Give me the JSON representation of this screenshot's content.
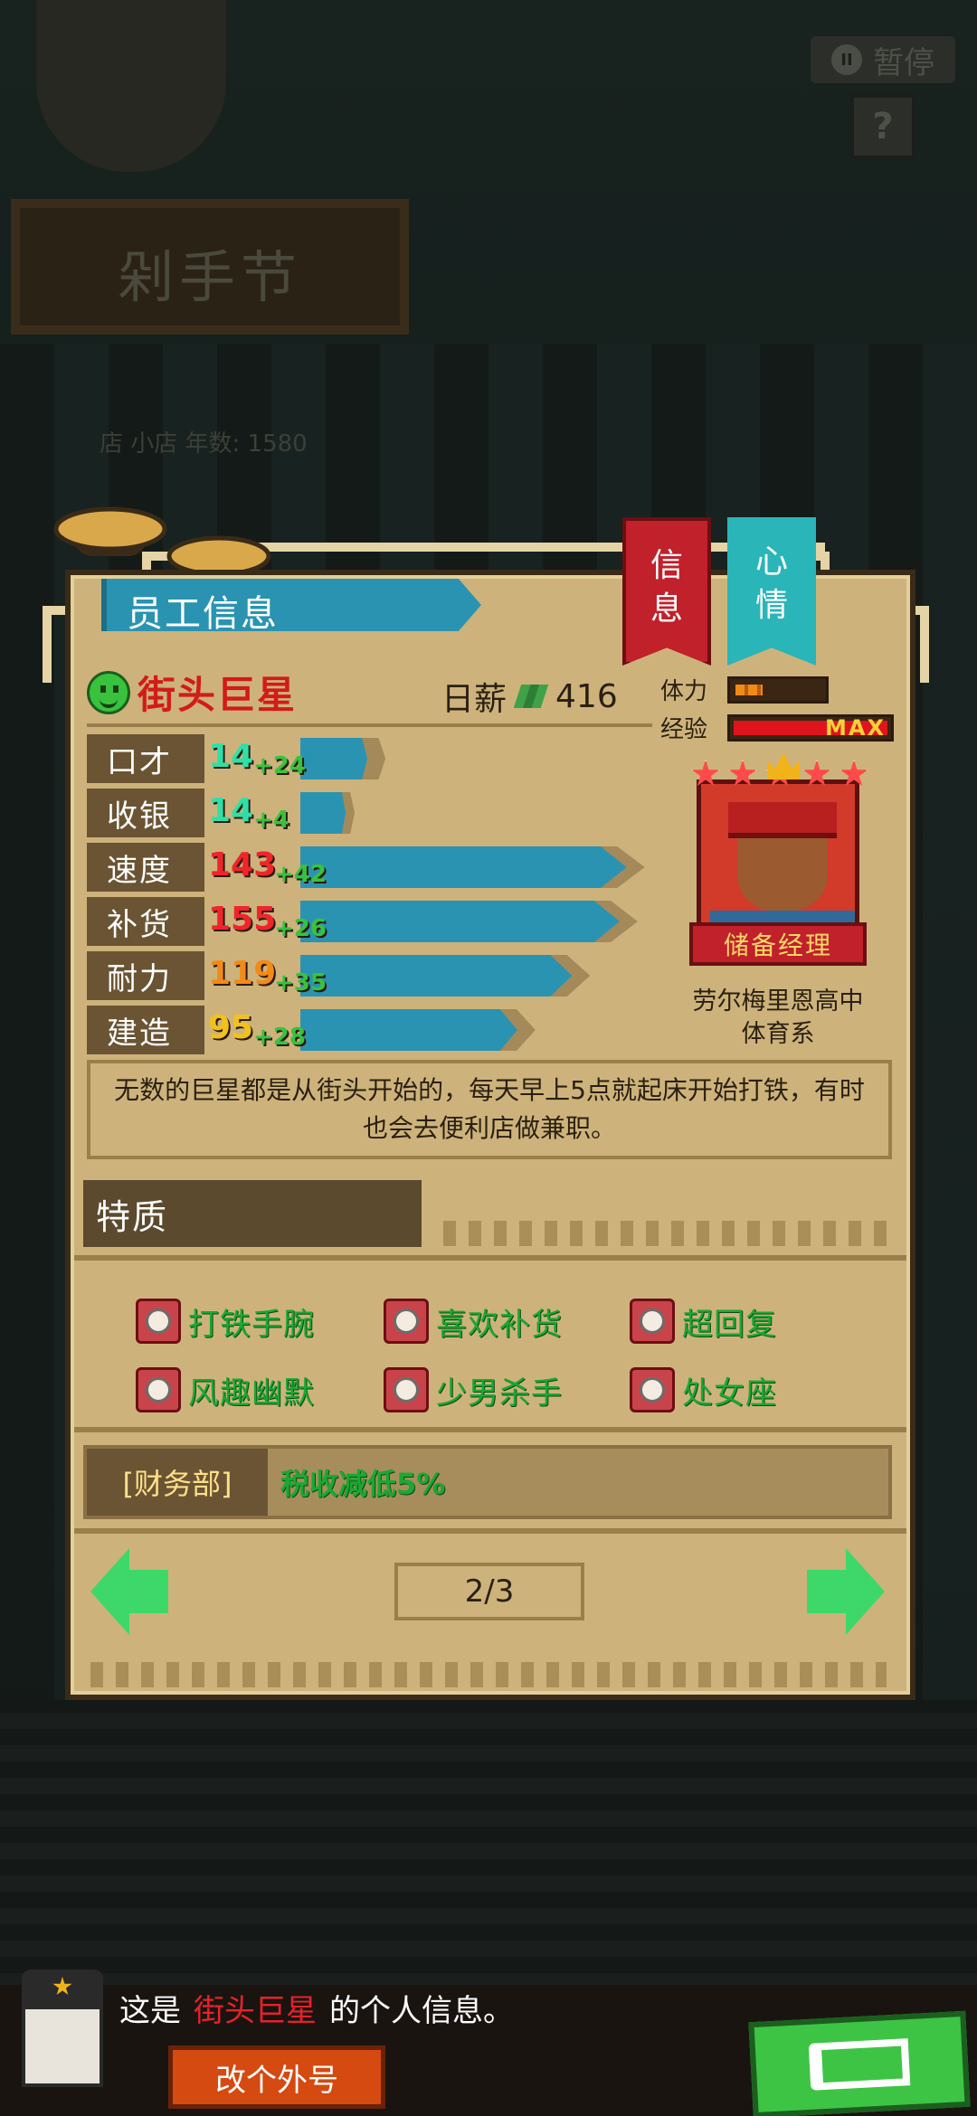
{
  "background": {
    "sign_text": "剁手节",
    "shop_text": "店 小店  年数: 1580"
  },
  "topbar": {
    "pause_label": "暂停",
    "help_label": "?"
  },
  "panel": {
    "header_title": "员工信息",
    "tab_info": [
      "信",
      "息"
    ],
    "tab_mood": [
      "心",
      "情"
    ]
  },
  "employee": {
    "name": "街头巨星",
    "salary_label": "日薪",
    "salary_value": "416",
    "stamina_label": "体力",
    "stamina_level": 0.3,
    "exp_label": "经验",
    "exp_level": 1.0,
    "exp_max_text": "MAX",
    "rank": "储备经理",
    "school_line1": "劳尔梅里恩高中",
    "school_line2": "体育系",
    "bio": "无数的巨星都是从街头开始的，每天早上5点就起床开始打铁，有时也会去便利店做兼职。"
  },
  "stats": [
    {
      "name": "口才",
      "value": "14",
      "bonus": "+24",
      "color": "#2ee0a8"
    },
    {
      "name": "收银",
      "value": "14",
      "bonus": "+4",
      "color": "#2ee0a8"
    },
    {
      "name": "速度",
      "value": "143",
      "bonus": "+42",
      "color": "#f0252a"
    },
    {
      "name": "补货",
      "value": "155",
      "bonus": "+26",
      "color": "#f0252a"
    },
    {
      "name": "耐力",
      "value": "119",
      "bonus": "+35",
      "color": "#f28a18"
    },
    {
      "name": "建造",
      "value": "95",
      "bonus": "+28",
      "color": "#f2c21a"
    }
  ],
  "traits": {
    "title": "特质",
    "items": [
      "打铁手腕",
      "喜欢补货",
      "超回复",
      "风趣幽默",
      "少男杀手",
      "处女座"
    ]
  },
  "department": {
    "name": "[财务部]",
    "effect": "税收减低5%"
  },
  "pager": {
    "text": "2/3"
  },
  "bottom": {
    "caption_prefix": "这是",
    "caption_name": "街头巨星",
    "caption_suffix": "的个人信息。",
    "outfit_button": "改个外号"
  },
  "colors": {
    "panel_bg": "#cdb37b",
    "accent_blue": "#2a93b1",
    "ribbon_red": "#c0212a",
    "ribbon_teal": "#2ab5b8",
    "trait_green": "#1aa832",
    "button_green": "#3ec445"
  }
}
